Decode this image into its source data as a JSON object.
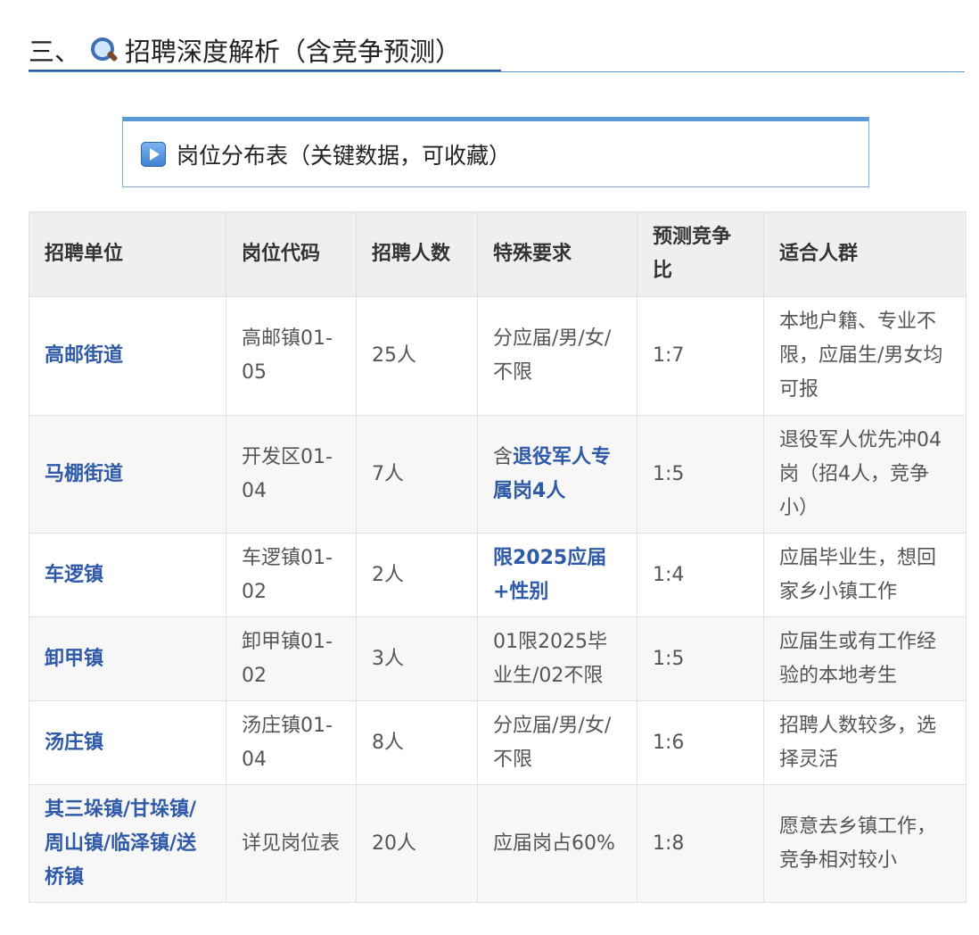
{
  "section": {
    "prefix": "三、",
    "icon": "magnifier-icon",
    "title": "招聘深度解析（含竞争预测）"
  },
  "subsection": {
    "icon": "play-button-icon",
    "title": "岗位分布表（关键数据，可收藏）"
  },
  "table": {
    "headers": [
      "招聘单位",
      "岗位代码",
      "招聘人数",
      "特殊要求",
      "预测竞争比",
      "适合人群"
    ],
    "rows": [
      {
        "unit": "高邮街道",
        "code": "高邮镇01-05",
        "count": "25人",
        "req_plain": "分应届/男/女/不限",
        "req_pre": "",
        "req_hl": "",
        "ratio": "1:7",
        "audience": "本地户籍、专业不限，应届生/男女均可报"
      },
      {
        "unit": "马棚街道",
        "code": "开发区01-04",
        "count": "7人",
        "req_plain": "",
        "req_pre": "含",
        "req_hl": "退役军人专属岗4人",
        "ratio": "1:5",
        "audience": "退役军人优先冲04岗（招4人，竞争小）"
      },
      {
        "unit": "车逻镇",
        "code": "车逻镇01-02",
        "count": "2人",
        "req_plain": "",
        "req_pre": "",
        "req_hl": "限2025应届+性别",
        "ratio": "1:4",
        "audience": "应届毕业生，想回家乡小镇工作"
      },
      {
        "unit": "卸甲镇",
        "code": "卸甲镇01-02",
        "count": "3人",
        "req_plain": "01限2025毕业生/02不限",
        "req_pre": "",
        "req_hl": "",
        "ratio": "1:5",
        "audience": "应届生或有工作经验的本地考生"
      },
      {
        "unit": "汤庄镇",
        "code": "汤庄镇01-04",
        "count": "8人",
        "req_plain": "分应届/男/女/不限",
        "req_pre": "",
        "req_hl": "",
        "ratio": "1:6",
        "audience": "招聘人数较多，选择灵活"
      },
      {
        "unit": "其三垛镇/甘垛镇/周山镇/临泽镇/送桥镇",
        "code": "详见岗位表",
        "count": "20人",
        "req_plain": "应届岗占60%",
        "req_pre": "",
        "req_hl": "",
        "ratio": "1:8",
        "audience": "愿意去乡镇工作，竞争相对较小"
      }
    ]
  }
}
